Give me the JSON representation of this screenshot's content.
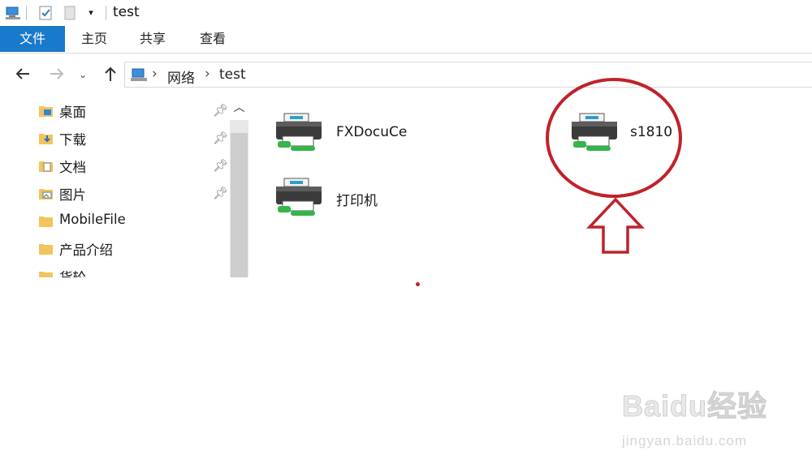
{
  "window": {
    "title": "test"
  },
  "ribbon": {
    "tabs": [
      "文件",
      "主页",
      "共享",
      "查看"
    ]
  },
  "address": {
    "crumbs": [
      "网络",
      "test"
    ]
  },
  "sidebar": {
    "items": [
      {
        "label": "桌面",
        "pinned": true
      },
      {
        "label": "下载",
        "pinned": true
      },
      {
        "label": "文档",
        "pinned": true
      },
      {
        "label": "图片",
        "pinned": true
      },
      {
        "label": "MobileFile",
        "pinned": false
      },
      {
        "label": "产品介绍",
        "pinned": false
      },
      {
        "label": "货轮",
        "pinned": false
      }
    ]
  },
  "content": {
    "printers": [
      {
        "name": "FXDocuCe"
      },
      {
        "name": "s1810"
      },
      {
        "name": "打印机"
      }
    ]
  },
  "watermark": {
    "brand": "Baidu经验",
    "url": "jingyan.baidu.com"
  },
  "colors": {
    "file_tab": "#1979ca",
    "annotation": "#c0222a"
  },
  "icons": {
    "title": [
      "computer-icon",
      "properties-icon",
      "new-folder-icon",
      "customize-dropdown-icon"
    ],
    "nav": [
      "back-arrow-icon",
      "forward-arrow-icon",
      "recent-dropdown-icon",
      "up-arrow-icon"
    ],
    "address": "network-computer-icon",
    "sidebar": [
      "folder-icon",
      "pin-icon"
    ],
    "content": "network-printer-icon"
  }
}
